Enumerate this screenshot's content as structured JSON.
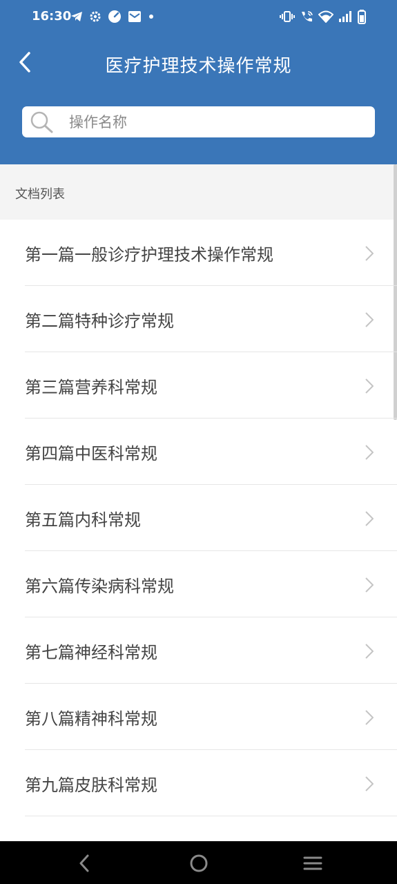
{
  "status_bar": {
    "time": "16:30",
    "left_icons": [
      "telegram-icon",
      "settings-icon",
      "speedometer-icon",
      "mail-icon",
      "dot-icon"
    ],
    "right_icons": [
      "vibrate-icon",
      "wifi-calling-icon",
      "wifi-icon",
      "signal-icon",
      "battery-icon"
    ]
  },
  "header": {
    "title": "医疗护理技术操作常规",
    "back_icon": "chevron-left-icon",
    "background_color": "#3a76b8"
  },
  "search": {
    "placeholder": "操作名称",
    "value": ""
  },
  "section": {
    "title": "文档列表"
  },
  "list": {
    "items": [
      {
        "label": "第一篇一般诊疗护理技术操作常规"
      },
      {
        "label": "第二篇特种诊疗常规"
      },
      {
        "label": "第三篇营养科常规"
      },
      {
        "label": "第四篇中医科常规"
      },
      {
        "label": "第五篇内科常规"
      },
      {
        "label": "第六篇传染病科常规"
      },
      {
        "label": "第七篇神经科常规"
      },
      {
        "label": "第八篇精神科常规"
      },
      {
        "label": "第九篇皮肤科常规"
      }
    ]
  },
  "system_nav": {
    "buttons": [
      "back-nav-icon",
      "home-nav-icon",
      "menu-nav-icon"
    ]
  }
}
